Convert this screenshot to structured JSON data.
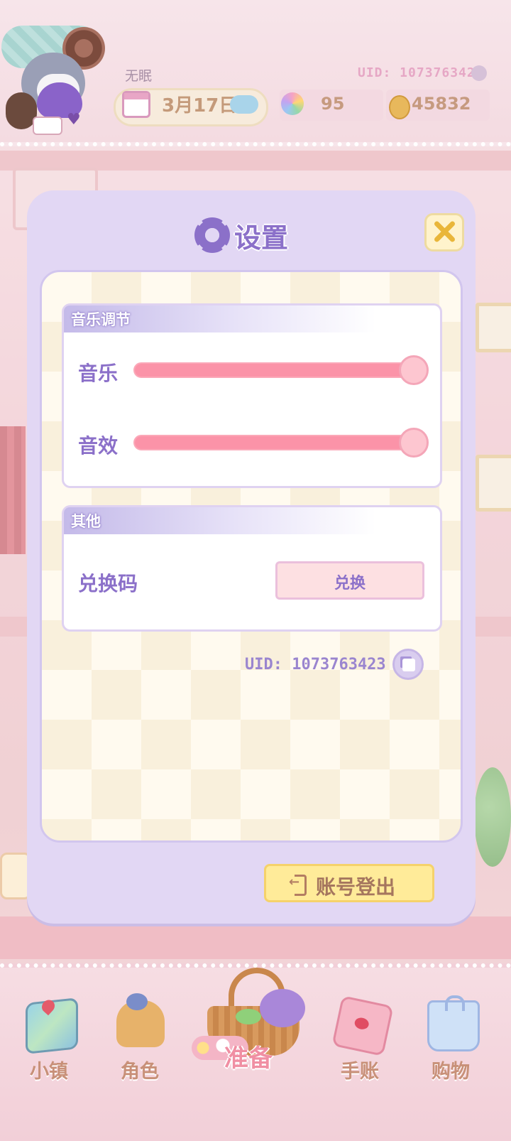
{
  "topbar": {
    "username": "无眠",
    "uid": "UID: 1073763423",
    "date": "3月17日",
    "gems": "95",
    "coins": "45832"
  },
  "settings": {
    "title": "设置",
    "music_section_title": "音乐调节",
    "music_label": "音乐",
    "music_level": 1.0,
    "sfx_label": "音效",
    "sfx_level": 1.0,
    "other_section_title": "其他",
    "redeem_code_label": "兑换码",
    "redeem_button_label": "兑换",
    "uid_text": "UID: 1073763423",
    "logout_label": "账号登出"
  },
  "bottom_nav": {
    "items": [
      {
        "label": "小镇",
        "icon": "map-icon"
      },
      {
        "label": "角色",
        "icon": "character-icon"
      },
      {
        "label": "准备",
        "icon": "basket-icon"
      },
      {
        "label": "手账",
        "icon": "journal-icon"
      },
      {
        "label": "购物",
        "icon": "shopping-bag-icon"
      }
    ]
  },
  "colors": {
    "accent_purple": "#8b70c9",
    "slider_pink": "#fb93a8",
    "logout_yellow": "#ffeb99",
    "modal_bg": "#e2d7f4"
  }
}
